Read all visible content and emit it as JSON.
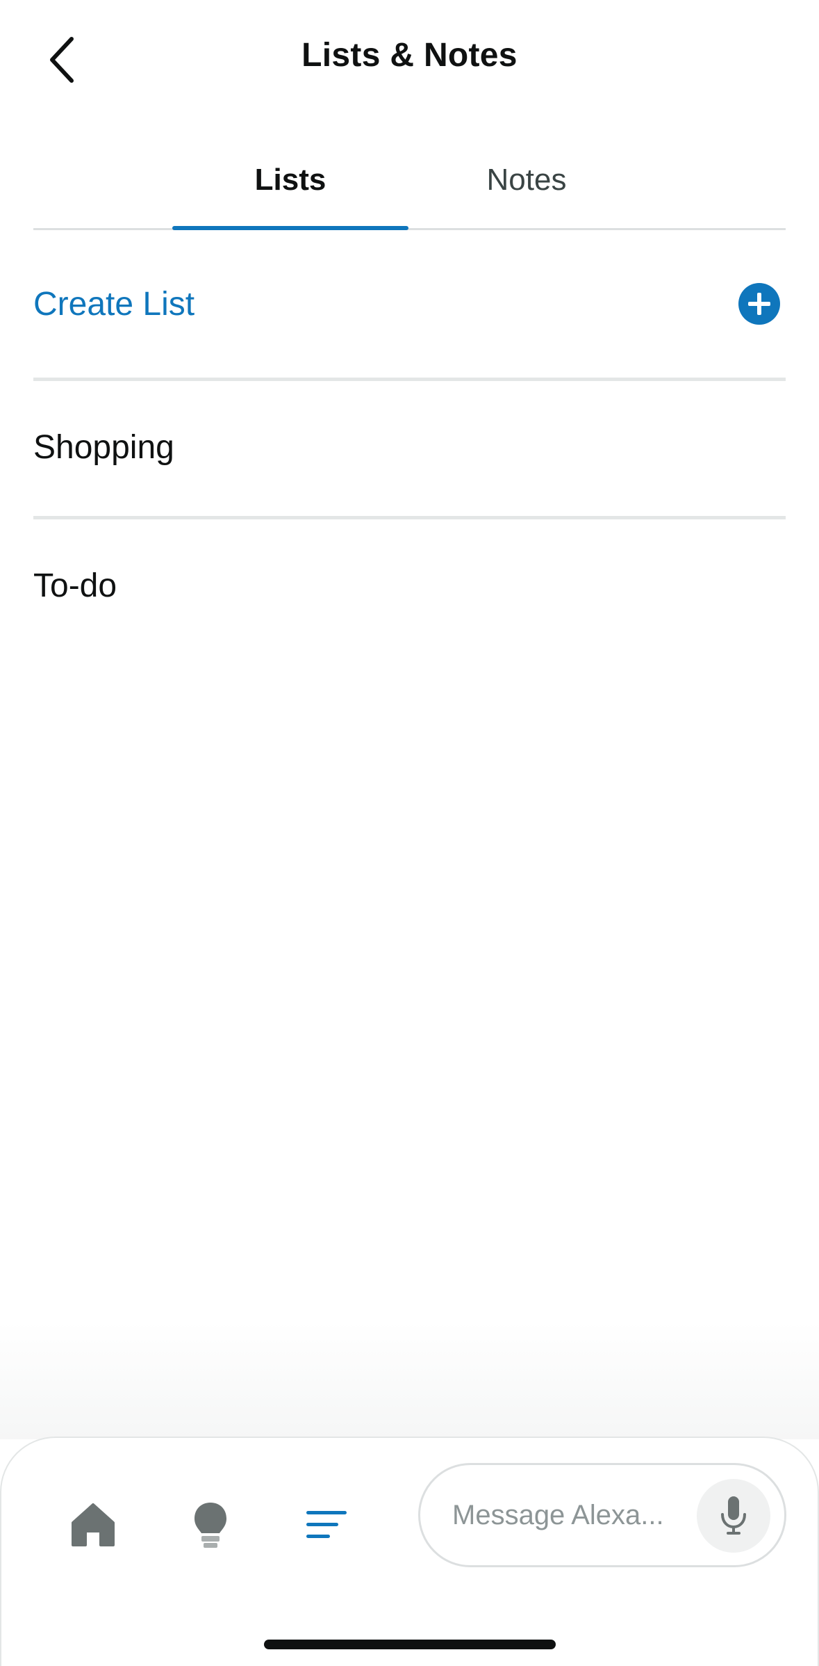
{
  "header": {
    "title": "Lists & Notes",
    "back_icon": "chevron-left-icon"
  },
  "tabs": [
    {
      "label": "Lists",
      "selected": true
    },
    {
      "label": "Notes",
      "selected": false
    }
  ],
  "create_list": {
    "label": "Create List",
    "icon": "plus-circle-icon"
  },
  "lists": [
    {
      "label": "Shopping"
    },
    {
      "label": "To-do"
    }
  ],
  "bottom_nav": {
    "items": [
      {
        "name": "home",
        "icon": "home-icon",
        "active": false
      },
      {
        "name": "bulb",
        "icon": "lightbulb-icon",
        "active": false
      },
      {
        "name": "lists",
        "icon": "lists-icon",
        "active": true
      }
    ],
    "message": {
      "placeholder": "Message Alexa...",
      "mic_icon": "microphone-icon"
    }
  },
  "colors": {
    "accent": "#0f76bc",
    "text": "#0f1111",
    "muted_text": "#3a4444",
    "divider": "#e3e6e6",
    "icon_gray": "#6b7272"
  }
}
